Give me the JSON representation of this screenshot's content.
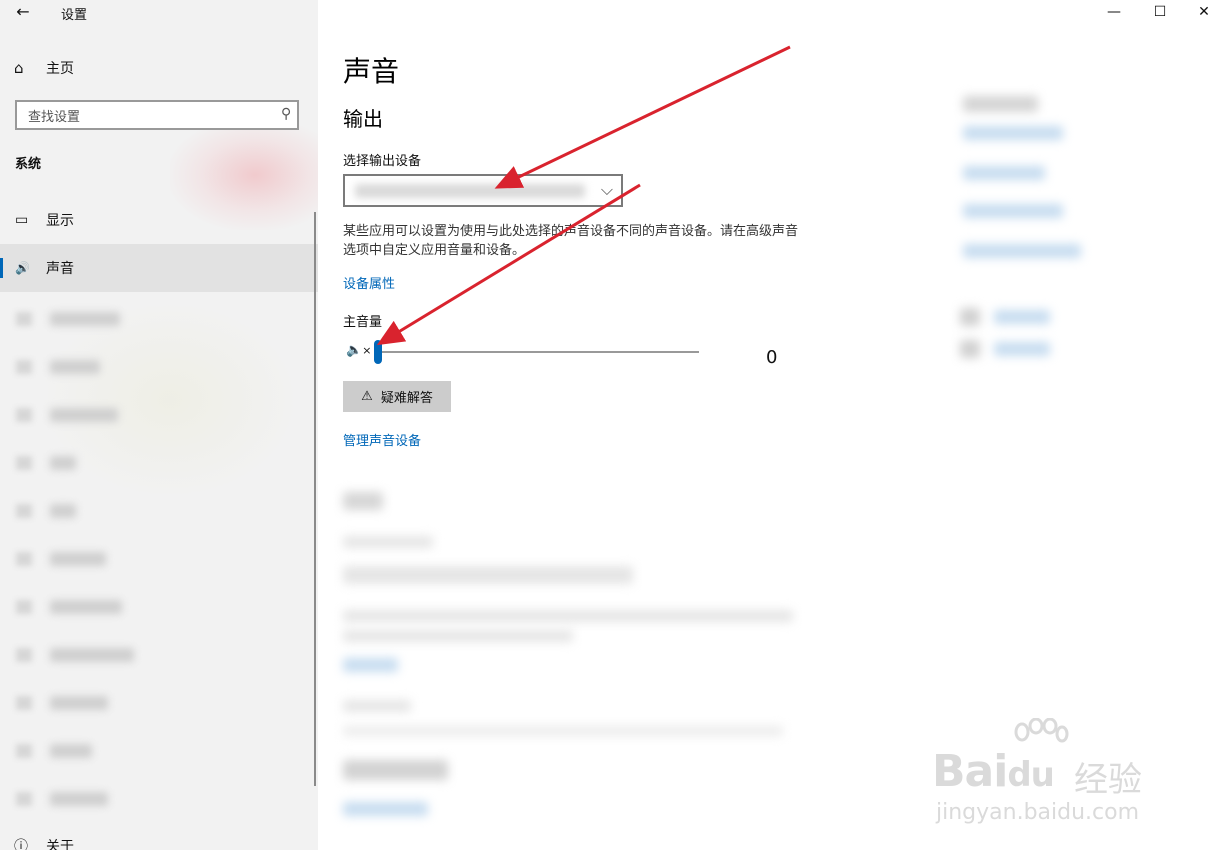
{
  "window": {
    "title": "设置",
    "back_icon": "←",
    "minimize_icon": "—",
    "maximize_icon": "☐",
    "close_icon": "✕"
  },
  "sidebar": {
    "home_icon": "⌂",
    "home_label": "主页",
    "search_placeholder": "查找设置",
    "search_icon": "⚲",
    "section_label": "系统",
    "items": [
      {
        "icon": "▭",
        "label": "显示",
        "active": false
      },
      {
        "icon": "🔊",
        "label": "声音",
        "active": true
      }
    ],
    "last_item_label": "关于"
  },
  "main": {
    "title": "声音",
    "output_heading": "输出",
    "select_device_label": "选择输出设备",
    "dropdown_chevron": "⌵",
    "description": "某些应用可以设置为使用与此处选择的声音设备不同的声音设备。请在高级声音选项中自定义应用音量和设备。",
    "device_properties_link": "设备属性",
    "master_volume_label": "主音量",
    "mute_icon": "🔇",
    "volume_value": "0",
    "volume_level": 0,
    "troubleshoot_icon": "⚠",
    "troubleshoot_label": "疑难解答",
    "manage_devices_link": "管理声音设备"
  },
  "colors": {
    "accent": "#0067b8",
    "arrow": "#d9232e"
  },
  "watermark": {
    "brand": "Bai",
    "brand_du": "du",
    "brand_cn": "经验",
    "url": "jingyan.baidu.com"
  }
}
